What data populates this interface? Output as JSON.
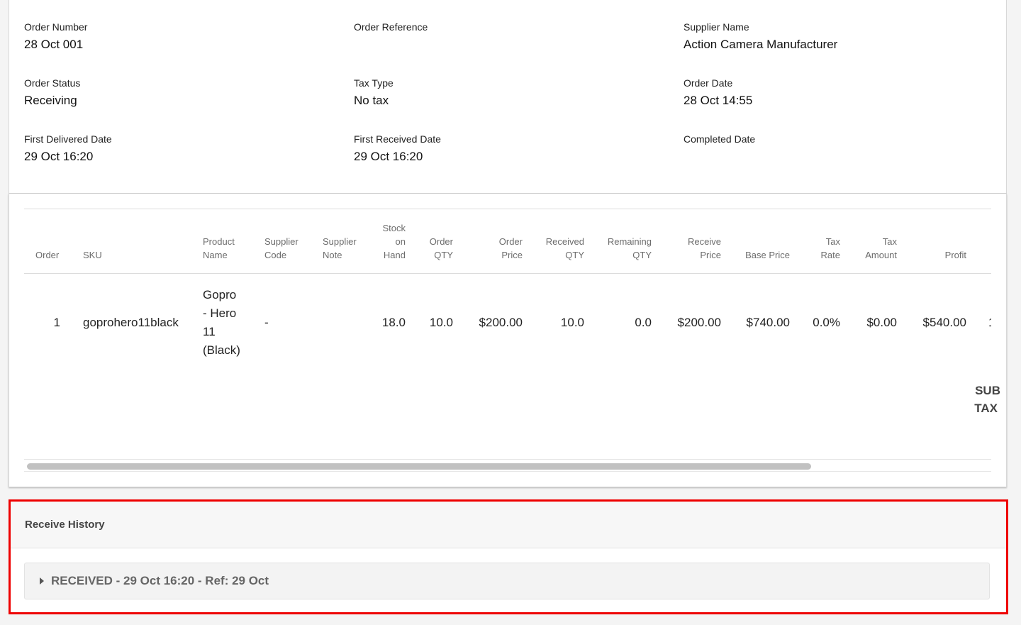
{
  "order_info": {
    "order_number_label": "Order Number",
    "order_number": "28 Oct 001",
    "order_reference_label": "Order Reference",
    "order_reference": "",
    "supplier_name_label": "Supplier Name",
    "supplier_name": "Action Camera Manufacturer",
    "order_status_label": "Order Status",
    "order_status": "Receiving",
    "tax_type_label": "Tax Type",
    "tax_type": "No tax",
    "order_date_label": "Order Date",
    "order_date": "28 Oct 14:55",
    "first_delivered_label": "First Delivered Date",
    "first_delivered": "29 Oct 16:20",
    "first_received_label": "First Received Date",
    "first_received": "29 Oct 16:20",
    "completed_label": "Completed Date",
    "completed": ""
  },
  "table": {
    "headers": {
      "order": "Order",
      "sku": "SKU",
      "product_name_1": "Product",
      "product_name_2": "Name",
      "supplier_code_1": "Supplier",
      "supplier_code_2": "Code",
      "supplier_note_1": "Supplier",
      "supplier_note_2": "Note",
      "stock_1": "Stock",
      "stock_2": "on",
      "stock_3": "Hand",
      "order_qty_1": "Order",
      "order_qty_2": "QTY",
      "order_price_1": "Order",
      "order_price_2": "Price",
      "received_qty_1": "Received",
      "received_qty_2": "QTY",
      "remaining_qty_1": "Remaining",
      "remaining_qty_2": "QTY",
      "receive_price_1": "Receive",
      "receive_price_2": "Price",
      "base_price": "Base Price",
      "tax_rate_1": "Tax",
      "tax_rate_2": "Rate",
      "tax_amount_1": "Tax",
      "tax_amount_2": "Amount",
      "profit": "Profit"
    },
    "rows": [
      {
        "order": "1",
        "sku": "goprohero11black",
        "product_name_lines": [
          "Gopro",
          "- Hero",
          "11",
          "(Black)"
        ],
        "supplier_code": "-",
        "supplier_note": "",
        "stock_on_hand": "18.0",
        "order_qty": "10.0",
        "order_price": "$200.00",
        "received_qty": "10.0",
        "remaining_qty": "0.0",
        "receive_price": "$200.00",
        "base_price": "$740.00",
        "tax_rate": "0.0%",
        "tax_amount": "$0.00",
        "profit": "$540.00",
        "cut_off": "1"
      }
    ],
    "summary": {
      "sub_label": "SUB",
      "tax_label": "TAX"
    }
  },
  "receive_history": {
    "title": "Receive History",
    "items": [
      {
        "label": "RECEIVED - 29 Oct 16:20 - Ref: 29 Oct"
      }
    ]
  }
}
